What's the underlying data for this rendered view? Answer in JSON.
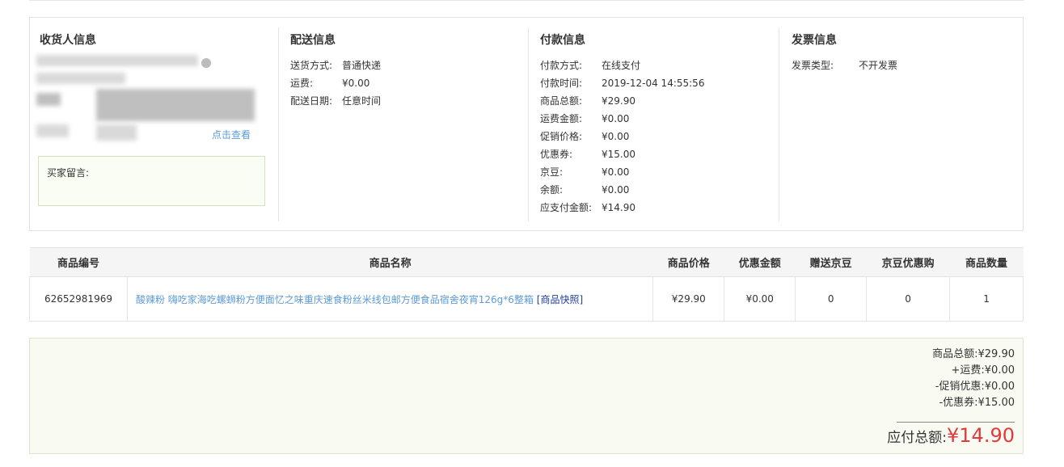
{
  "receiver": {
    "title": "收货人信息",
    "view_link": "点击查看",
    "message_label": "买家留言:"
  },
  "delivery": {
    "title": "配送信息",
    "rows": [
      {
        "k": "送货方式:",
        "v": "普通快递"
      },
      {
        "k": "运费:",
        "v": "¥0.00"
      },
      {
        "k": "配送日期:",
        "v": "任意时间"
      }
    ]
  },
  "payment": {
    "title": "付款信息",
    "rows": [
      {
        "k": "付款方式:",
        "v": "在线支付"
      },
      {
        "k": "付款时间:",
        "v": "2019-12-04 14:55:56"
      },
      {
        "k": "商品总额:",
        "v": "¥29.90"
      },
      {
        "k": "运费金额:",
        "v": "¥0.00"
      },
      {
        "k": "促销价格:",
        "v": "¥0.00"
      },
      {
        "k": "优惠券:",
        "v": "¥15.00"
      },
      {
        "k": "京豆:",
        "v": "¥0.00"
      },
      {
        "k": "余额:",
        "v": "¥0.00"
      },
      {
        "k": "应支付金额:",
        "v": "¥14.90"
      }
    ]
  },
  "invoice": {
    "title": "发票信息",
    "rows": [
      {
        "k": "发票类型:",
        "v": "不开发票"
      }
    ]
  },
  "table": {
    "headers": [
      "商品编号",
      "商品名称",
      "商品价格",
      "优惠金额",
      "赠送京豆",
      "京豆优惠购",
      "商品数量"
    ],
    "row": {
      "id": "62652981969",
      "name": "酸辣粉 嗨吃家海吃螺蛳粉方便面忆之味重庆速食粉丝米线包邮方便食品宿舍夜宵126g*6整箱",
      "snapshot": "[商品快照]",
      "price": "¥29.90",
      "discount": "¥0.00",
      "beans": "0",
      "bean_buy": "0",
      "qty": "1"
    }
  },
  "summary": {
    "lines": [
      "商品总额:¥29.90",
      "+运费:¥0.00",
      "-促销优惠:¥0.00",
      "-优惠券:¥15.00"
    ],
    "total_label": "应付总额:",
    "total_amount": "¥14.90"
  }
}
